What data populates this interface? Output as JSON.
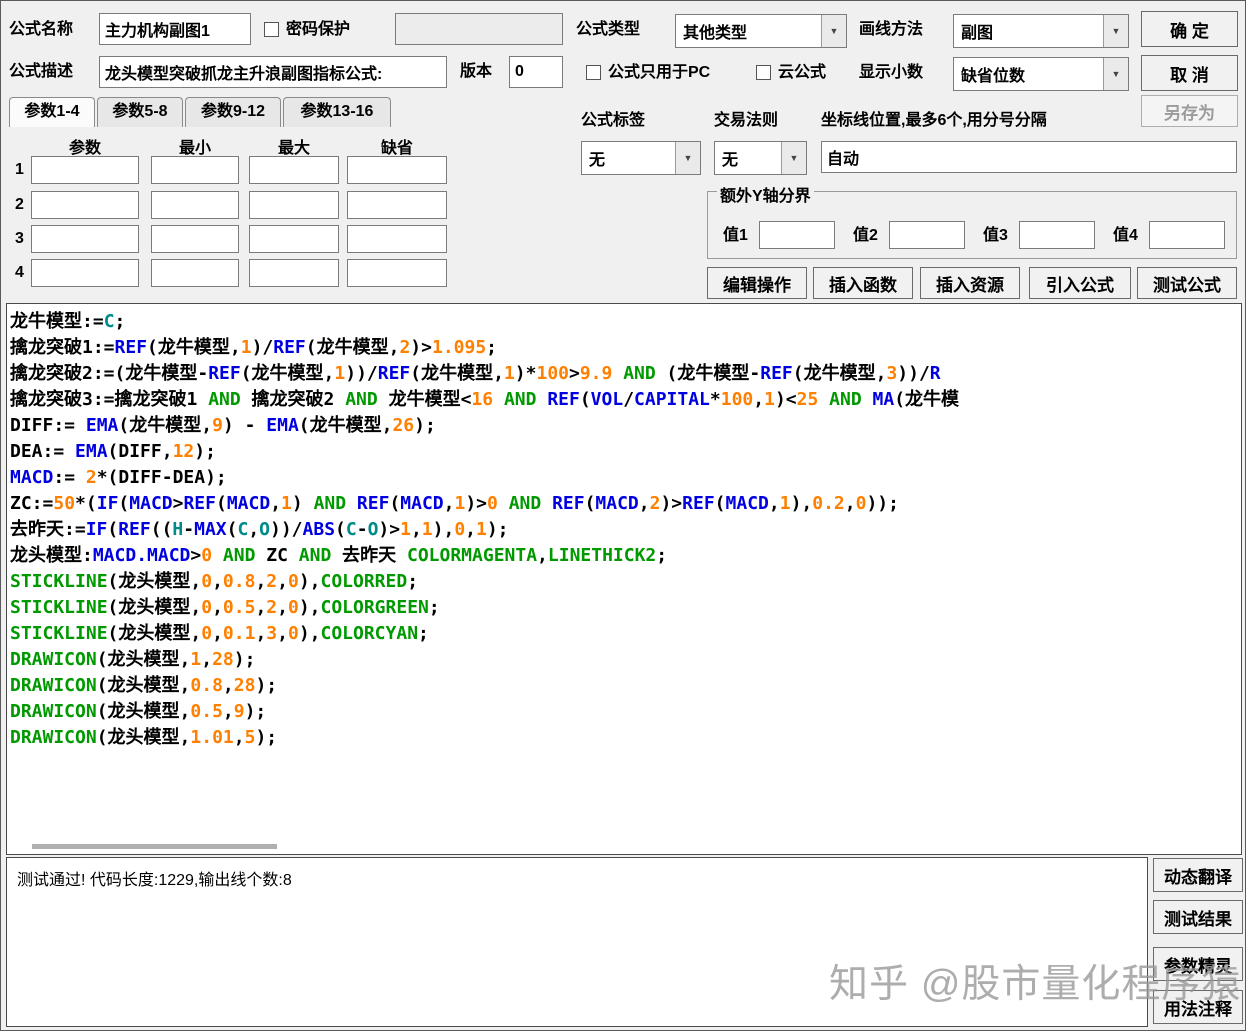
{
  "header": {
    "formula_name_label": "公式名称",
    "formula_name_value": "主力机构副图1",
    "password_protect_label": "密码保护",
    "formula_type_label": "公式类型",
    "formula_type_value": "其他类型",
    "draw_method_label": "画线方法",
    "draw_method_value": "副图",
    "ok_button": "确 定",
    "formula_desc_label": "公式描述",
    "formula_desc_value": "龙头模型突破抓龙主升浪副图指标公式:",
    "version_label": "版本",
    "version_value": "0",
    "pc_only_label": "公式只用于PC",
    "cloud_formula_label": "云公式",
    "show_decimal_label": "显示小数",
    "show_decimal_value": "缺省位数",
    "cancel_button": "取 消",
    "save_as_button": "另存为"
  },
  "params": {
    "tabs": [
      "参数1-4",
      "参数5-8",
      "参数9-12",
      "参数13-16"
    ],
    "columns": [
      "参数",
      "最小",
      "最大",
      "缺省"
    ],
    "rows": [
      "1",
      "2",
      "3",
      "4"
    ]
  },
  "middle": {
    "formula_tag_label": "公式标签",
    "formula_tag_value": "无",
    "trade_rule_label": "交易法则",
    "trade_rule_value": "无",
    "coord_label": "坐标线位置,最多6个,用分号分隔",
    "coord_value": "自动",
    "extra_y_title": "额外Y轴分界",
    "value_labels": [
      "值1",
      "值2",
      "值3",
      "值4"
    ],
    "action_buttons": [
      "编辑操作",
      "插入函数",
      "插入资源",
      "引入公式",
      "测试公式"
    ]
  },
  "code": {
    "colors": {
      "p": "#000000",
      "f": "#0000E0",
      "k": "#009900",
      "n": "#FF8000",
      "c": "#008B8B"
    },
    "lines": [
      [
        {
          "t": "龙牛模型:=",
          "c": "p"
        },
        {
          "t": "C",
          "c": "c"
        },
        {
          "t": ";",
          "c": "p"
        }
      ],
      [
        {
          "t": "擒龙突破1:=",
          "c": "p"
        },
        {
          "t": "REF",
          "c": "f"
        },
        {
          "t": "(龙牛模型,",
          "c": "p"
        },
        {
          "t": "1",
          "c": "n"
        },
        {
          "t": ")/",
          "c": "p"
        },
        {
          "t": "REF",
          "c": "f"
        },
        {
          "t": "(龙牛模型,",
          "c": "p"
        },
        {
          "t": "2",
          "c": "n"
        },
        {
          "t": ")>",
          "c": "p"
        },
        {
          "t": "1.095",
          "c": "n"
        },
        {
          "t": ";",
          "c": "p"
        }
      ],
      [
        {
          "t": "擒龙突破2:=(龙牛模型-",
          "c": "p"
        },
        {
          "t": "REF",
          "c": "f"
        },
        {
          "t": "(龙牛模型,",
          "c": "p"
        },
        {
          "t": "1",
          "c": "n"
        },
        {
          "t": "))/",
          "c": "p"
        },
        {
          "t": "REF",
          "c": "f"
        },
        {
          "t": "(龙牛模型,",
          "c": "p"
        },
        {
          "t": "1",
          "c": "n"
        },
        {
          "t": ")*",
          "c": "p"
        },
        {
          "t": "100",
          "c": "n"
        },
        {
          "t": ">",
          "c": "p"
        },
        {
          "t": "9.9",
          "c": "n"
        },
        {
          "t": " ",
          "c": "p"
        },
        {
          "t": "AND",
          "c": "k"
        },
        {
          "t": " (龙牛模型-",
          "c": "p"
        },
        {
          "t": "REF",
          "c": "f"
        },
        {
          "t": "(龙牛模型,",
          "c": "p"
        },
        {
          "t": "3",
          "c": "n"
        },
        {
          "t": "))/",
          "c": "p"
        },
        {
          "t": "R",
          "c": "f"
        }
      ],
      [
        {
          "t": "擒龙突破3:=擒龙突破1 ",
          "c": "p"
        },
        {
          "t": "AND",
          "c": "k"
        },
        {
          "t": " 擒龙突破2 ",
          "c": "p"
        },
        {
          "t": "AND",
          "c": "k"
        },
        {
          "t": " 龙牛模型<",
          "c": "p"
        },
        {
          "t": "16",
          "c": "n"
        },
        {
          "t": " ",
          "c": "p"
        },
        {
          "t": "AND",
          "c": "k"
        },
        {
          "t": " ",
          "c": "p"
        },
        {
          "t": "REF",
          "c": "f"
        },
        {
          "t": "(",
          "c": "p"
        },
        {
          "t": "VOL",
          "c": "f"
        },
        {
          "t": "/",
          "c": "p"
        },
        {
          "t": "CAPITAL",
          "c": "f"
        },
        {
          "t": "*",
          "c": "p"
        },
        {
          "t": "100",
          "c": "n"
        },
        {
          "t": ",",
          "c": "p"
        },
        {
          "t": "1",
          "c": "n"
        },
        {
          "t": ")<",
          "c": "p"
        },
        {
          "t": "25",
          "c": "n"
        },
        {
          "t": " ",
          "c": "p"
        },
        {
          "t": "AND",
          "c": "k"
        },
        {
          "t": " ",
          "c": "p"
        },
        {
          "t": "MA",
          "c": "f"
        },
        {
          "t": "(龙牛模",
          "c": "p"
        }
      ],
      [
        {
          "t": "DIFF:= ",
          "c": "p"
        },
        {
          "t": "EMA",
          "c": "f"
        },
        {
          "t": "(龙牛模型,",
          "c": "p"
        },
        {
          "t": "9",
          "c": "n"
        },
        {
          "t": ") - ",
          "c": "p"
        },
        {
          "t": "EMA",
          "c": "f"
        },
        {
          "t": "(龙牛模型,",
          "c": "p"
        },
        {
          "t": "26",
          "c": "n"
        },
        {
          "t": ");",
          "c": "p"
        }
      ],
      [
        {
          "t": "DEA:= ",
          "c": "p"
        },
        {
          "t": "EMA",
          "c": "f"
        },
        {
          "t": "(DIFF,",
          "c": "p"
        },
        {
          "t": "12",
          "c": "n"
        },
        {
          "t": ");",
          "c": "p"
        }
      ],
      [
        {
          "t": "MACD",
          "c": "f"
        },
        {
          "t": ":= ",
          "c": "p"
        },
        {
          "t": "2",
          "c": "n"
        },
        {
          "t": "*(DIFF-DEA);",
          "c": "p"
        }
      ],
      [
        {
          "t": "ZC:=",
          "c": "p"
        },
        {
          "t": "50",
          "c": "n"
        },
        {
          "t": "*(",
          "c": "p"
        },
        {
          "t": "IF",
          "c": "f"
        },
        {
          "t": "(",
          "c": "p"
        },
        {
          "t": "MACD",
          "c": "f"
        },
        {
          "t": ">",
          "c": "p"
        },
        {
          "t": "REF",
          "c": "f"
        },
        {
          "t": "(",
          "c": "p"
        },
        {
          "t": "MACD",
          "c": "f"
        },
        {
          "t": ",",
          "c": "p"
        },
        {
          "t": "1",
          "c": "n"
        },
        {
          "t": ") ",
          "c": "p"
        },
        {
          "t": "AND",
          "c": "k"
        },
        {
          "t": " ",
          "c": "p"
        },
        {
          "t": "REF",
          "c": "f"
        },
        {
          "t": "(",
          "c": "p"
        },
        {
          "t": "MACD",
          "c": "f"
        },
        {
          "t": ",",
          "c": "p"
        },
        {
          "t": "1",
          "c": "n"
        },
        {
          "t": ")>",
          "c": "p"
        },
        {
          "t": "0",
          "c": "n"
        },
        {
          "t": " ",
          "c": "p"
        },
        {
          "t": "AND",
          "c": "k"
        },
        {
          "t": " ",
          "c": "p"
        },
        {
          "t": "REF",
          "c": "f"
        },
        {
          "t": "(",
          "c": "p"
        },
        {
          "t": "MACD",
          "c": "f"
        },
        {
          "t": ",",
          "c": "p"
        },
        {
          "t": "2",
          "c": "n"
        },
        {
          "t": ")>",
          "c": "p"
        },
        {
          "t": "REF",
          "c": "f"
        },
        {
          "t": "(",
          "c": "p"
        },
        {
          "t": "MACD",
          "c": "f"
        },
        {
          "t": ",",
          "c": "p"
        },
        {
          "t": "1",
          "c": "n"
        },
        {
          "t": "),",
          "c": "p"
        },
        {
          "t": "0.2",
          "c": "n"
        },
        {
          "t": ",",
          "c": "p"
        },
        {
          "t": "0",
          "c": "n"
        },
        {
          "t": "));",
          "c": "p"
        }
      ],
      [
        {
          "t": "去昨天:=",
          "c": "p"
        },
        {
          "t": "IF",
          "c": "f"
        },
        {
          "t": "(",
          "c": "p"
        },
        {
          "t": "REF",
          "c": "f"
        },
        {
          "t": "((",
          "c": "p"
        },
        {
          "t": "H",
          "c": "c"
        },
        {
          "t": "-",
          "c": "p"
        },
        {
          "t": "MAX",
          "c": "f"
        },
        {
          "t": "(",
          "c": "p"
        },
        {
          "t": "C",
          "c": "c"
        },
        {
          "t": ",",
          "c": "p"
        },
        {
          "t": "O",
          "c": "c"
        },
        {
          "t": "))/",
          "c": "p"
        },
        {
          "t": "ABS",
          "c": "f"
        },
        {
          "t": "(",
          "c": "p"
        },
        {
          "t": "C",
          "c": "c"
        },
        {
          "t": "-",
          "c": "p"
        },
        {
          "t": "O",
          "c": "c"
        },
        {
          "t": ")>",
          "c": "p"
        },
        {
          "t": "1",
          "c": "n"
        },
        {
          "t": ",",
          "c": "p"
        },
        {
          "t": "1",
          "c": "n"
        },
        {
          "t": "),",
          "c": "p"
        },
        {
          "t": "0",
          "c": "n"
        },
        {
          "t": ",",
          "c": "p"
        },
        {
          "t": "1",
          "c": "n"
        },
        {
          "t": ");",
          "c": "p"
        }
      ],
      [
        {
          "t": "龙头模型:",
          "c": "p"
        },
        {
          "t": "MACD.MACD",
          "c": "f"
        },
        {
          "t": ">",
          "c": "p"
        },
        {
          "t": "0",
          "c": "n"
        },
        {
          "t": " ",
          "c": "p"
        },
        {
          "t": "AND",
          "c": "k"
        },
        {
          "t": " ZC ",
          "c": "p"
        },
        {
          "t": "AND",
          "c": "k"
        },
        {
          "t": " 去昨天 ",
          "c": "p"
        },
        {
          "t": "COLORMAGENTA",
          "c": "k"
        },
        {
          "t": ",",
          "c": "p"
        },
        {
          "t": "LINETHICK2",
          "c": "k"
        },
        {
          "t": ";",
          "c": "p"
        }
      ],
      [
        {
          "t": "STICKLINE",
          "c": "k"
        },
        {
          "t": "(龙头模型,",
          "c": "p"
        },
        {
          "t": "0",
          "c": "n"
        },
        {
          "t": ",",
          "c": "p"
        },
        {
          "t": "0.8",
          "c": "n"
        },
        {
          "t": ",",
          "c": "p"
        },
        {
          "t": "2",
          "c": "n"
        },
        {
          "t": ",",
          "c": "p"
        },
        {
          "t": "0",
          "c": "n"
        },
        {
          "t": "),",
          "c": "p"
        },
        {
          "t": "COLORRED",
          "c": "k"
        },
        {
          "t": ";",
          "c": "p"
        }
      ],
      [
        {
          "t": "STICKLINE",
          "c": "k"
        },
        {
          "t": "(龙头模型,",
          "c": "p"
        },
        {
          "t": "0",
          "c": "n"
        },
        {
          "t": ",",
          "c": "p"
        },
        {
          "t": "0.5",
          "c": "n"
        },
        {
          "t": ",",
          "c": "p"
        },
        {
          "t": "2",
          "c": "n"
        },
        {
          "t": ",",
          "c": "p"
        },
        {
          "t": "0",
          "c": "n"
        },
        {
          "t": "),",
          "c": "p"
        },
        {
          "t": "COLORGREEN",
          "c": "k"
        },
        {
          "t": ";",
          "c": "p"
        }
      ],
      [
        {
          "t": "STICKLINE",
          "c": "k"
        },
        {
          "t": "(龙头模型,",
          "c": "p"
        },
        {
          "t": "0",
          "c": "n"
        },
        {
          "t": ",",
          "c": "p"
        },
        {
          "t": "0.1",
          "c": "n"
        },
        {
          "t": ",",
          "c": "p"
        },
        {
          "t": "3",
          "c": "n"
        },
        {
          "t": ",",
          "c": "p"
        },
        {
          "t": "0",
          "c": "n"
        },
        {
          "t": "),",
          "c": "p"
        },
        {
          "t": "COLORCYAN",
          "c": "k"
        },
        {
          "t": ";",
          "c": "p"
        }
      ],
      [
        {
          "t": "DRAWICON",
          "c": "k"
        },
        {
          "t": "(龙头模型,",
          "c": "p"
        },
        {
          "t": "1",
          "c": "n"
        },
        {
          "t": ",",
          "c": "p"
        },
        {
          "t": "28",
          "c": "n"
        },
        {
          "t": ");",
          "c": "p"
        }
      ],
      [
        {
          "t": "DRAWICON",
          "c": "k"
        },
        {
          "t": "(龙头模型,",
          "c": "p"
        },
        {
          "t": "0.8",
          "c": "n"
        },
        {
          "t": ",",
          "c": "p"
        },
        {
          "t": "28",
          "c": "n"
        },
        {
          "t": ");",
          "c": "p"
        }
      ],
      [
        {
          "t": "DRAWICON",
          "c": "k"
        },
        {
          "t": "(龙头模型,",
          "c": "p"
        },
        {
          "t": "0.5",
          "c": "n"
        },
        {
          "t": ",",
          "c": "p"
        },
        {
          "t": "9",
          "c": "n"
        },
        {
          "t": ");",
          "c": "p"
        }
      ],
      [
        {
          "t": "DRAWICON",
          "c": "k"
        },
        {
          "t": "(龙头模型,",
          "c": "p"
        },
        {
          "t": "1.01",
          "c": "n"
        },
        {
          "t": ",",
          "c": "p"
        },
        {
          "t": "5",
          "c": "n"
        },
        {
          "t": ");",
          "c": "p"
        }
      ]
    ]
  },
  "footer": {
    "status_text": "测试通过! 代码长度:1229,输出线个数:8",
    "side_buttons": [
      "动态翻译",
      "测试结果",
      "参数精灵",
      "用法注释"
    ],
    "watermark": "知乎 @股市量化程序猿"
  }
}
